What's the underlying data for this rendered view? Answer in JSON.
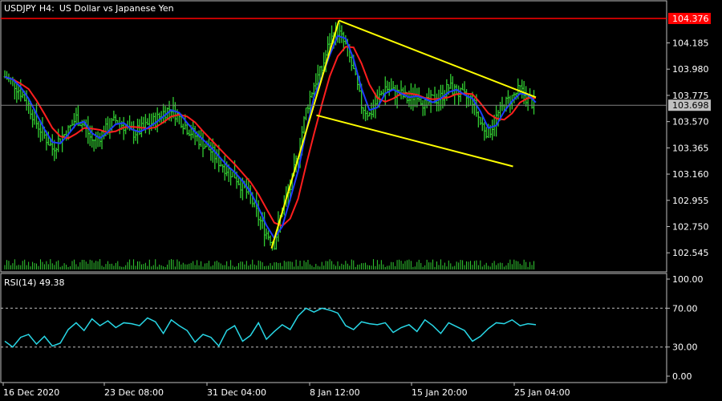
{
  "header": {
    "symbol": "USDJPY",
    "timeframe": "H4:",
    "description": "US Dollar vs Japanese Yen"
  },
  "colors": {
    "background": "#000000",
    "grid_border": "#c0c0c0",
    "candle": "#32cd32",
    "ma_fast": "#1e3cff",
    "ma_slow": "#ff1e1e",
    "trendline": "#ffff00",
    "rsi": "#28d7e6",
    "label_text": "#ffffff",
    "price_tag_red": "#ff0000",
    "price_tag_grey": "#c0c0c0"
  },
  "chart_data": {
    "type": "line",
    "series": [
      {
        "values": [
          103.92,
          103.88,
          103.8,
          103.7,
          103.56,
          103.46,
          103.36,
          103.44,
          103.5,
          103.6,
          103.54,
          103.42,
          103.46,
          103.52,
          103.58,
          103.54,
          103.48,
          103.5,
          103.54,
          103.58,
          103.64,
          103.68,
          103.6,
          103.52,
          103.46,
          103.4,
          103.34,
          103.26,
          103.2,
          103.15,
          103.06,
          102.98,
          102.82,
          102.7,
          102.62,
          102.88,
          103.05,
          103.32,
          103.66,
          103.86,
          103.98,
          104.2,
          104.28,
          104.16,
          103.96,
          103.7,
          103.62,
          103.74,
          103.84,
          103.8,
          103.78,
          103.74,
          103.8,
          103.7,
          103.74,
          103.76,
          103.84,
          103.8,
          103.76,
          103.74,
          103.56,
          103.48,
          103.6,
          103.7,
          103.76,
          103.82,
          103.74,
          103.7
        ]
      }
    ],
    "ylim": [
      102.44,
      104.47
    ],
    "y_ticks": [
      "104.185",
      "103.980",
      "103.775",
      "103.570",
      "103.365",
      "103.160",
      "102.955",
      "102.750",
      "102.545"
    ],
    "x_ticks": [
      "16 Dec 2020",
      "23 Dec 08:00",
      "31 Dec 04:00",
      "8 Jan 12:00",
      "15 Jan 20:00",
      "25 Jan 04:00"
    ],
    "price_line_high": "104.376",
    "price_line_current": "103.698",
    "trendlines": [
      {
        "from": [
          0.475,
          102.58
        ],
        "to": [
          0.595,
          104.36
        ]
      },
      {
        "from": [
          0.595,
          104.36
        ],
        "to": [
          0.965,
          103.76
        ]
      },
      {
        "from": [
          0.555,
          103.62
        ],
        "to": [
          0.905,
          103.22
        ]
      }
    ]
  },
  "rsi": {
    "label": "RSI(14) 49.38",
    "y_ticks": [
      "100.00",
      "70.00",
      "30.00",
      "0.00"
    ],
    "levels": [
      70,
      30
    ],
    "ylim": [
      0,
      100
    ],
    "values": [
      36,
      30,
      40,
      43,
      33,
      41,
      31,
      34,
      48,
      55,
      47,
      59,
      52,
      57,
      50,
      55,
      54,
      52,
      60,
      56,
      44,
      58,
      52,
      47,
      35,
      43,
      40,
      31,
      47,
      52,
      36,
      42,
      55,
      38,
      46,
      53,
      48,
      62,
      70,
      66,
      70,
      68,
      65,
      52,
      48,
      56,
      54,
      53,
      55,
      45,
      50,
      53,
      46,
      58,
      52,
      44,
      55,
      51,
      47,
      36,
      41,
      49,
      55,
      54,
      58,
      52,
      54,
      53
    ]
  }
}
